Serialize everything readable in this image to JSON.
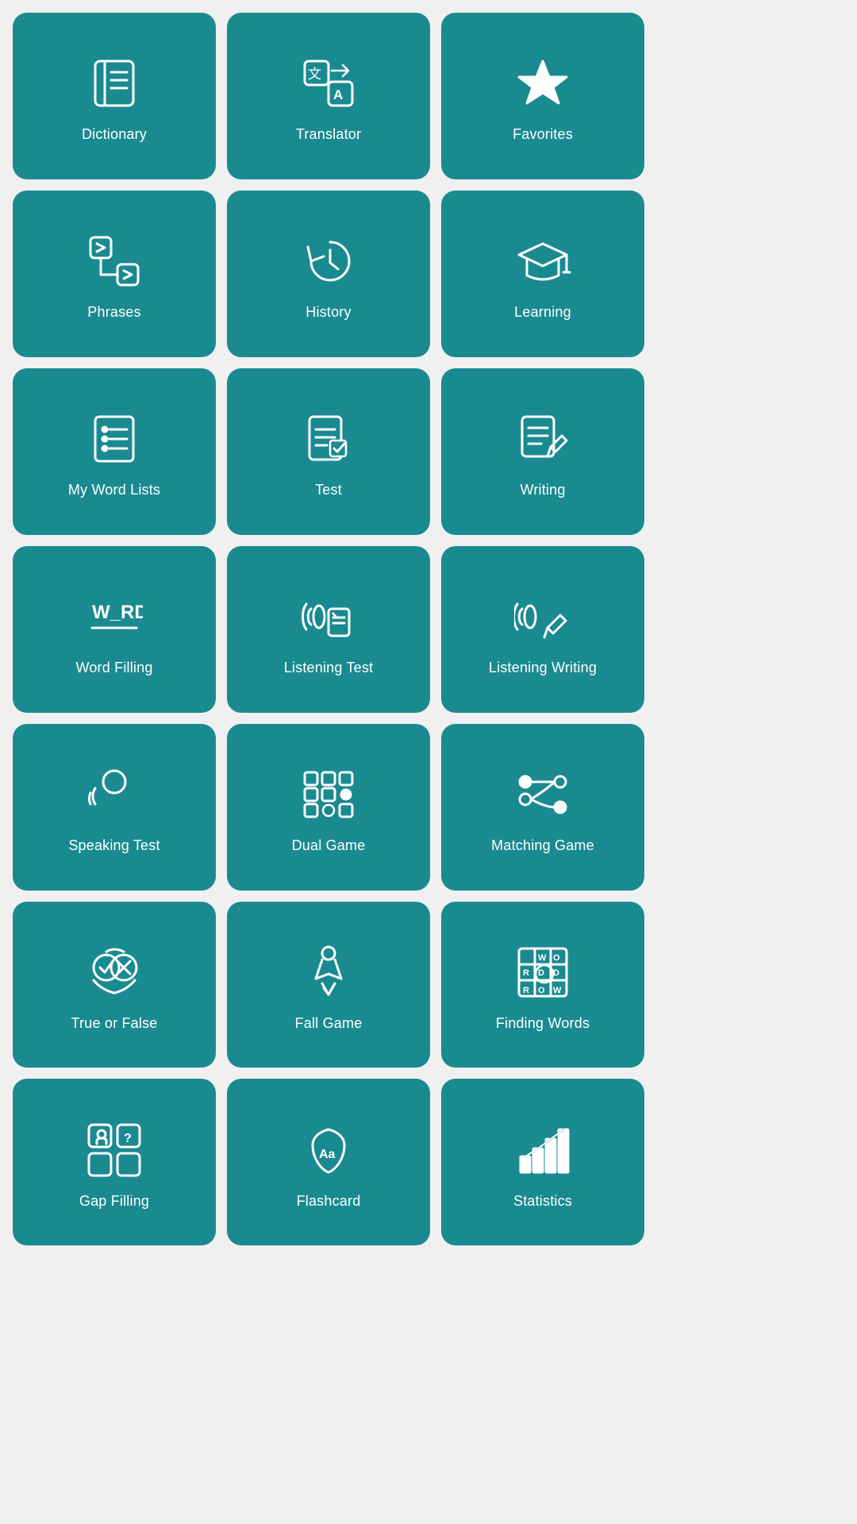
{
  "cards": [
    {
      "id": "dictionary",
      "label": "Dictionary"
    },
    {
      "id": "translator",
      "label": "Translator"
    },
    {
      "id": "favorites",
      "label": "Favorites"
    },
    {
      "id": "phrases",
      "label": "Phrases"
    },
    {
      "id": "history",
      "label": "History"
    },
    {
      "id": "learning",
      "label": "Learning"
    },
    {
      "id": "my-word-lists",
      "label": "My Word Lists"
    },
    {
      "id": "test",
      "label": "Test"
    },
    {
      "id": "writing",
      "label": "Writing"
    },
    {
      "id": "word-filling",
      "label": "Word Filling"
    },
    {
      "id": "listening-test",
      "label": "Listening Test"
    },
    {
      "id": "listening-writing",
      "label": "Listening Writing"
    },
    {
      "id": "speaking-test",
      "label": "Speaking Test"
    },
    {
      "id": "dual-game",
      "label": "Dual Game"
    },
    {
      "id": "matching-game",
      "label": "Matching Game"
    },
    {
      "id": "true-or-false",
      "label": "True or False"
    },
    {
      "id": "fall-game",
      "label": "Fall Game"
    },
    {
      "id": "finding-words",
      "label": "Finding Words"
    },
    {
      "id": "gap-filling",
      "label": "Gap Filling"
    },
    {
      "id": "flashcard",
      "label": "Flashcard"
    },
    {
      "id": "statistics",
      "label": "Statistics"
    }
  ]
}
